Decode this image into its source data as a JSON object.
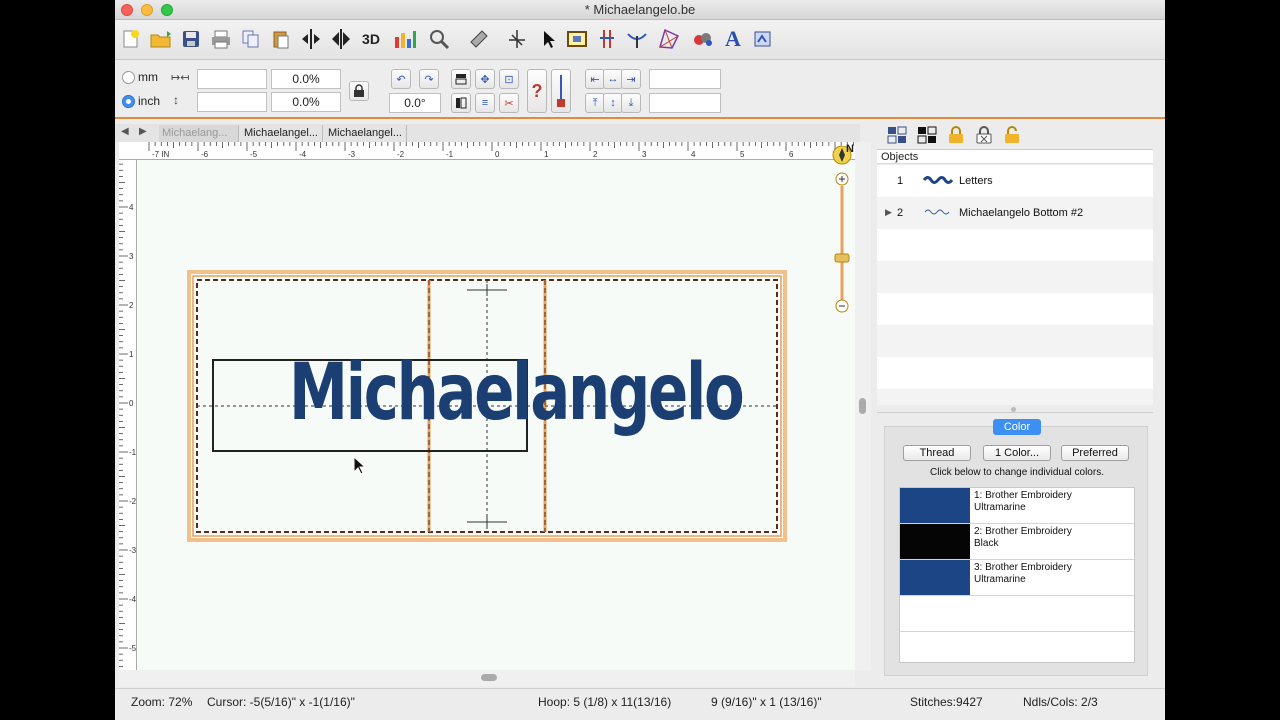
{
  "window": {
    "title": "* Michaelangelo.be"
  },
  "toolbar": {
    "icons": [
      "new-icon",
      "open-icon",
      "save-icon",
      "print-icon",
      "copy-icon",
      "paste-icon",
      "mirror-horizontal-icon",
      "mirror-vertical-icon",
      "3d-view-icon",
      "chart-icon",
      "zoom-icon",
      "ruler-icon",
      "stitch-icon",
      "select-arrow-icon",
      "hoop-icon",
      "needle-icon",
      "bend-icon",
      "shape-icon",
      "color-sort-icon",
      "text-icon",
      "design-icon"
    ],
    "label_3d": "3D",
    "label_text": "A"
  },
  "options": {
    "unit_mm": "mm",
    "unit_inch": "inch",
    "width_value": "",
    "height_value": "",
    "width_percent": "0.0%",
    "height_percent": "0.0%",
    "rotation": "0.0°",
    "x_value": "",
    "y_value": ""
  },
  "tabs": [
    "Michaelang...",
    "Michaelangel...",
    "Michaelangel..."
  ],
  "ruler": {
    "h_labels": [
      "-7 IN",
      "-6",
      "-5",
      "-4",
      "-3",
      "-2",
      "-1",
      "0",
      "1",
      "2",
      "3",
      "4",
      "5",
      "6"
    ],
    "v_labels": [
      "4",
      "3",
      "2",
      "1",
      "0",
      "-1",
      "-2",
      "-3",
      "-4",
      "-5"
    ]
  },
  "canvas": {
    "design_text": "Michaelangelo"
  },
  "compass": {
    "label": "N"
  },
  "objects": {
    "header": "Objects",
    "rows": [
      {
        "index": "1",
        "expand": "",
        "name": "Letters"
      },
      {
        "index": "2",
        "expand": "▶",
        "name": "Michaelangelo Bottom #2"
      }
    ]
  },
  "color_panel": {
    "tab": "Color",
    "thread_button": "Thread",
    "one_color_button": "1 Color...",
    "preferred_button": "Preferred",
    "hint": "Click below to change individual colors.",
    "colors": [
      {
        "line1": "1: Brother Embroidery",
        "line2": "Ultramarine",
        "hex": "#1c4585"
      },
      {
        "line1": "2: Brother Embroidery",
        "line2": "Black",
        "hex": "#050505"
      },
      {
        "line1": "3: Brother Embroidery",
        "line2": "Ultramarine",
        "hex": "#1c4585"
      }
    ]
  },
  "status": {
    "zoom": "Zoom: 72%",
    "cursor": "Cursor: -5(5/16)\" x -1(1/16)\"",
    "hoop": "Hoop: 5 (1/8) x 11(13/16)",
    "size": "9 (9/16)\" x 1 (13/16)\"",
    "stitches": "Stitches:9427",
    "needles": "Ndls/Cols: 2/3"
  },
  "theme": {
    "accent": "#e08a3c",
    "design_blue": "#1c3f73",
    "select_blue": "#3d8ff3"
  }
}
